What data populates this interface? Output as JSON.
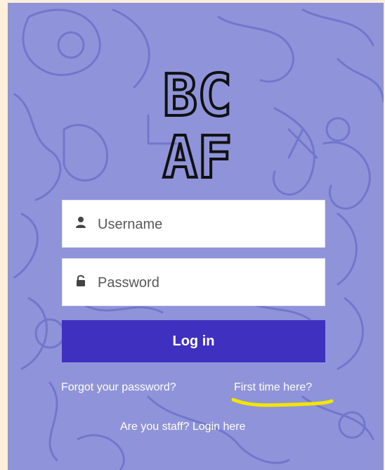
{
  "logo": {
    "line1": "BC",
    "line2": "AF"
  },
  "form": {
    "username_placeholder": "Username",
    "password_placeholder": "Password",
    "username_icon": "user-icon",
    "password_icon": "lock-icon",
    "login_label": "Log in"
  },
  "links": {
    "forgot_password": "Forgot your password?",
    "first_time": "First time here?",
    "staff_login": "Are you staff? Login here"
  },
  "colors": {
    "page_background": "#fcefdc",
    "panel_background": "#8f93da",
    "doodle_lines": "#7277cc",
    "button": "#4030bf",
    "highlight": "#f2e600"
  }
}
